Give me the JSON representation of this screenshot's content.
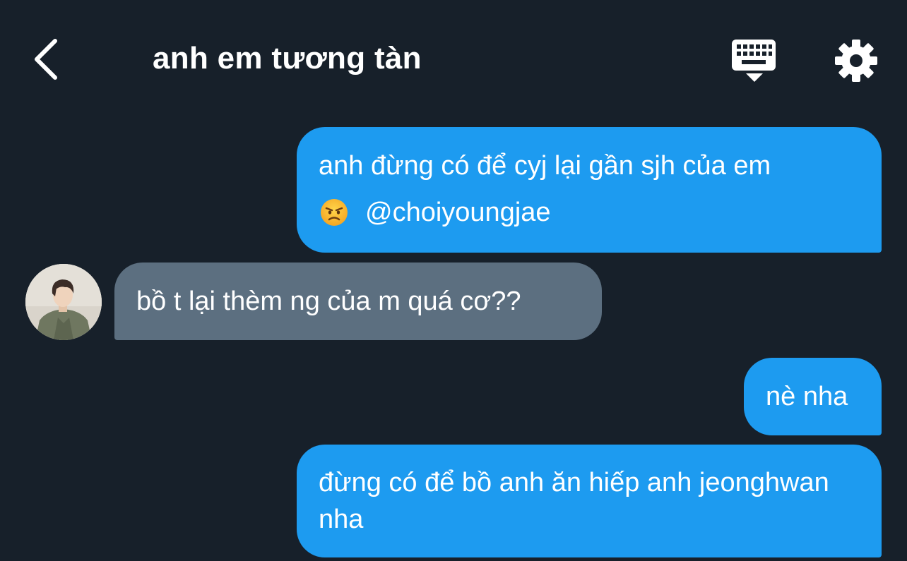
{
  "header": {
    "title": "anh em tương tàn",
    "back_icon": "chevron-left-icon",
    "keyboard_icon": "keyboard-hide-icon",
    "settings_icon": "gear-icon"
  },
  "messages": [
    {
      "direction": "outgoing",
      "line1": "anh đừng có để cyj lại gần sjh của em",
      "emoji": "angry-face-emoji",
      "mention": "@choiyoungjae"
    },
    {
      "direction": "incoming",
      "text": "bồ t lại thèm ng của m quá cơ??"
    },
    {
      "direction": "outgoing",
      "text": "nè nha"
    },
    {
      "direction": "outgoing",
      "text": "đừng có để bồ anh ăn hiếp anh jeonghwan nha"
    }
  ],
  "colors": {
    "background": "#17202a",
    "outgoing_bubble": "#1d9bf0",
    "incoming_bubble": "#5c6f80",
    "text": "#ffffff"
  }
}
